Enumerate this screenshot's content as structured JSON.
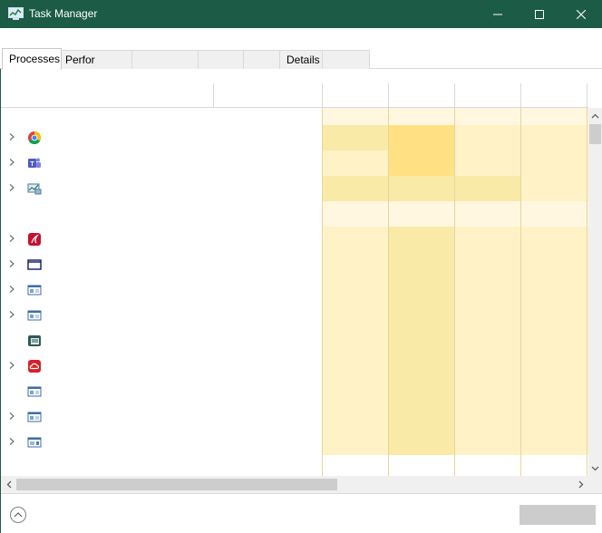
{
  "window": {
    "title": "Task Manager"
  },
  "tabs": [
    {
      "label": "Processes"
    },
    {
      "label": "Perfor"
    },
    {
      "label": ""
    },
    {
      "label": ""
    },
    {
      "label": ""
    },
    {
      "label": "Details"
    },
    {
      "label": ""
    }
  ],
  "rows": [
    {
      "icon": "none",
      "expandable": false,
      "heat": [
        "#fff7e0",
        "#fff7e0",
        "#fff7e0",
        "#fff7e0"
      ]
    },
    {
      "icon": "chrome-icon",
      "expandable": true,
      "heat": [
        "#faeaa8",
        "#ffe183",
        "#fff2c7",
        "#fff2c7"
      ]
    },
    {
      "icon": "teams-icon",
      "expandable": true,
      "heat": [
        "#fff2c7",
        "#ffe183",
        "#fff2c7",
        "#fff2c7"
      ]
    },
    {
      "icon": "remote-desktop-icon",
      "expandable": true,
      "heat": [
        "#faeaa8",
        "#faeaa8",
        "#faeaa8",
        "#fff2c7"
      ]
    },
    {
      "icon": "none",
      "expandable": false,
      "heat": [
        "#fff7e0",
        "#fff7e0",
        "#fff7e0",
        "#fff7e0"
      ]
    },
    {
      "icon": "acrobat-red-icon",
      "expandable": true,
      "heat": [
        "#fff2c7",
        "#faeaa8",
        "#fff2c7",
        "#fff2c7"
      ]
    },
    {
      "icon": "window-frame-icon",
      "expandable": true,
      "heat": [
        "#fff2c7",
        "#faeaa8",
        "#fff2c7",
        "#fff2c7"
      ]
    },
    {
      "icon": "app-window-icon",
      "expandable": true,
      "heat": [
        "#fff2c7",
        "#faeaa8",
        "#fff2c7",
        "#fff2c7"
      ]
    },
    {
      "icon": "app-window-icon",
      "expandable": true,
      "heat": [
        "#fff2c7",
        "#faeaa8",
        "#fff2c7",
        "#fff2c7"
      ]
    },
    {
      "icon": "notes-green-icon",
      "expandable": false,
      "heat": [
        "#fff2c7",
        "#faeaa8",
        "#fff2c7",
        "#fff2c7"
      ]
    },
    {
      "icon": "creative-cloud-icon",
      "expandable": true,
      "heat": [
        "#fff2c7",
        "#faeaa8",
        "#fff2c7",
        "#fff2c7"
      ]
    },
    {
      "icon": "app-window-icon",
      "expandable": false,
      "heat": [
        "#fff2c7",
        "#faeaa8",
        "#fff2c7",
        "#fff2c7"
      ]
    },
    {
      "icon": "app-window-icon",
      "expandable": true,
      "heat": [
        "#fff2c7",
        "#faeaa8",
        "#fff2c7",
        "#fff2c7"
      ]
    },
    {
      "icon": "service-window-icon",
      "expandable": true,
      "heat": [
        "#fff2c7",
        "#faeaa8",
        "#fff2c7",
        "#fff2c7"
      ]
    }
  ],
  "colors": {
    "titlebar": "#1c5b45",
    "heat_low": "#fff2c7",
    "heat_mid": "#faeaa8",
    "heat_high": "#ffe183",
    "heat_faint": "#fff7e0"
  }
}
